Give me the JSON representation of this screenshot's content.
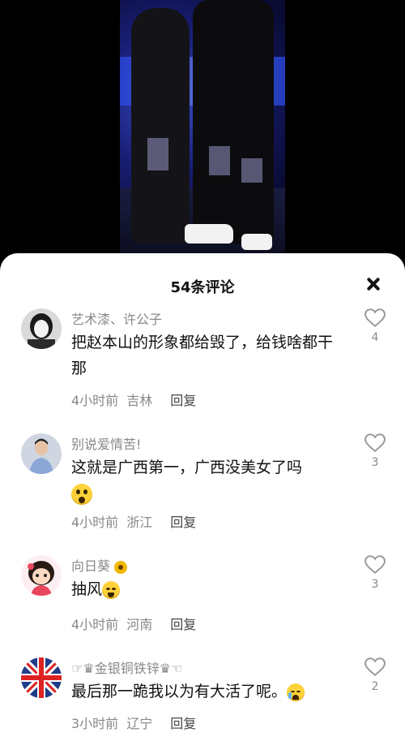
{
  "colors": {
    "accent": "#111111",
    "meta": "#888888",
    "sheet": "#ffffff"
  },
  "header": {
    "title": "54条评论",
    "close_icon": "close-icon"
  },
  "comments": [
    {
      "user": "艺术漆、许公子",
      "text": "把赵本山的形象都给毁了，给钱啥都干那",
      "time": "4小时前",
      "location": "吉林",
      "reply": "回复",
      "likes": "4"
    },
    {
      "user": "别说爱情苦!",
      "text": "这就是广西第一，广西没美女了吗",
      "emoji": "shocked-emoji",
      "time": "4小时前",
      "location": "浙江",
      "reply": "回复",
      "likes": "3"
    },
    {
      "user": "向日葵",
      "user_icon": "sunflower-icon",
      "text": "抽风",
      "emoji": "smiling-emoji",
      "time": "4小时前",
      "location": "河南",
      "reply": "回复",
      "likes": "3"
    },
    {
      "user": "☞♛金银铜铁锌♛☜",
      "text": "最后那一跪我以为有大活了呢。",
      "emoji": "crying-emoji",
      "time": "3小时前",
      "location": "辽宁",
      "reply": "回复",
      "likes": "2"
    }
  ]
}
